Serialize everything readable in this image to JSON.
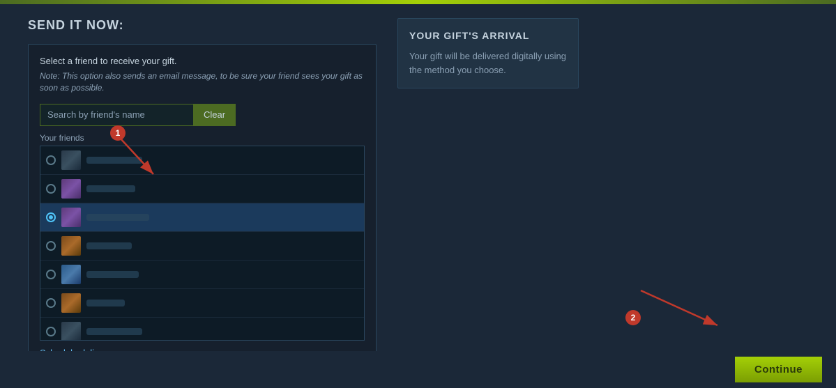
{
  "topBar": {},
  "sendItNow": {
    "title": "SEND IT NOW:",
    "selectFriendText": "Select a friend to receive your gift.",
    "noteText": "Note: This option also sends an email message, to be sure your friend sees your gift as soon as possible.",
    "searchPlaceholder": "Search by friend's name",
    "clearButton": "Clear",
    "friendsLabel": "Your friends",
    "scheduleButton": "Schedule delivery...",
    "friends": [
      {
        "id": 1,
        "nameWidth": 80,
        "avatarType": "dark",
        "selected": false,
        "radioChecked": false
      },
      {
        "id": 2,
        "nameWidth": 70,
        "avatarType": "purple",
        "selected": false,
        "radioChecked": false
      },
      {
        "id": 3,
        "nameWidth": 90,
        "avatarType": "purple-dark",
        "selected": true,
        "radioChecked": true
      },
      {
        "id": 4,
        "nameWidth": 65,
        "avatarType": "orange",
        "selected": false,
        "radioChecked": false
      },
      {
        "id": 5,
        "nameWidth": 75,
        "avatarType": "blue",
        "selected": false,
        "radioChecked": false
      },
      {
        "id": 6,
        "nameWidth": 55,
        "avatarType": "orange",
        "selected": false,
        "radioChecked": false
      },
      {
        "id": 7,
        "nameWidth": 80,
        "avatarType": "dark",
        "selected": false,
        "radioChecked": false
      },
      {
        "id": 8,
        "nameWidth": 70,
        "avatarType": "dark",
        "selected": false,
        "radioChecked": false
      }
    ]
  },
  "giftArrival": {
    "title": "YOUR GIFT'S ARRIVAL",
    "text": "Your gift will be delivered digitally using the method you choose."
  },
  "continueButton": "Continue",
  "annotations": {
    "one": "1",
    "two": "2"
  }
}
